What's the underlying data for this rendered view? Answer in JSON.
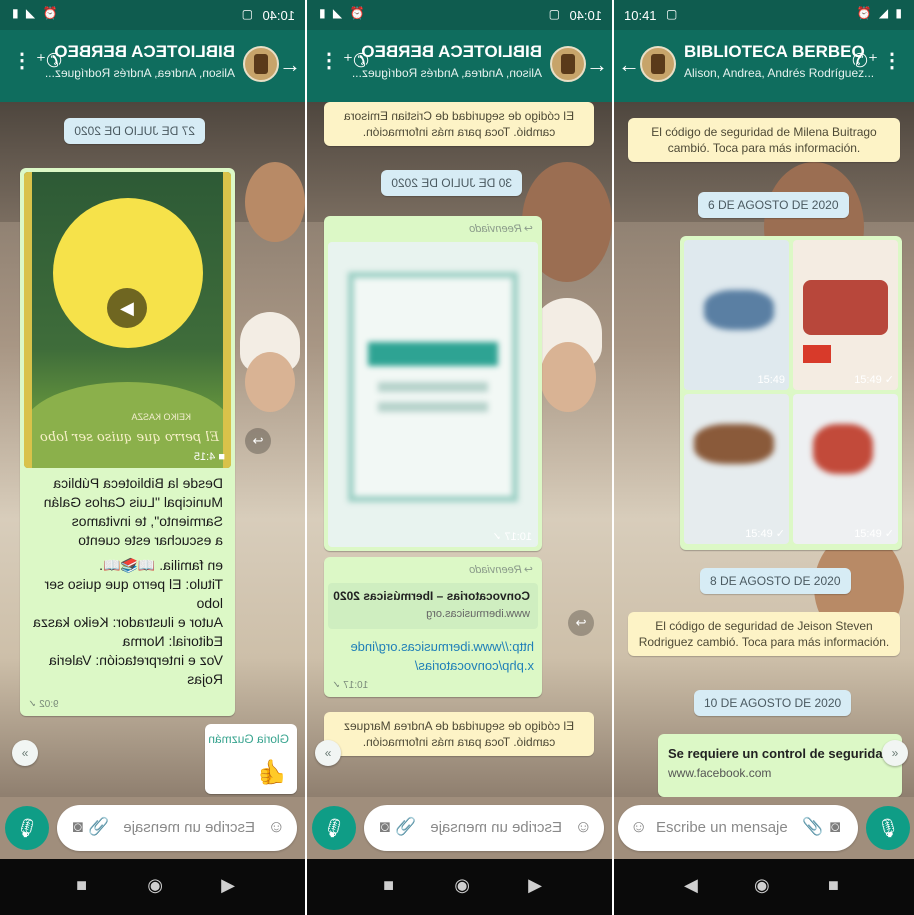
{
  "colors": {
    "header": "#0f6d5e",
    "statusbar": "#0f5c4f",
    "outgoing_bubble": "#dcf8c6",
    "date_chip": "#d7ecf5",
    "system_note": "#fdf3c6",
    "mic": "#0f9d86"
  },
  "screens": [
    {
      "mirrored": true,
      "status": {
        "time": "10:40"
      },
      "header": {
        "title": "BIBLIOTECA BERBEO",
        "subtitle": "Alison, Andrea, Andrés Rodríguez..."
      },
      "date_chip": "27 DE JULIO DE 2020",
      "video": {
        "title_on_cover": "El perro que quiso ser lobo",
        "author_on_cover": "KEIKO KASZA",
        "duration": "4:15"
      },
      "caption": [
        "Desde la Biblioteca Pública",
        "Municipal \"Luis Carlos Galán",
        "Sarmiento\", te invitamos",
        "a escuchar este cuento",
        "en familia. 📖📚📖.",
        "Titulo: El perro que quiso ser lobo",
        "Autor e ilustrador: Keiko kasza",
        "Editorial: Norma",
        "Voz e interpretación: Valeria Rojas"
      ],
      "caption_time": "9:02",
      "incoming": {
        "sender": "Gloria Guzmán",
        "emoji": "👍"
      },
      "input_placeholder": "Escribe un mensaje"
    },
    {
      "mirrored": true,
      "status": {
        "time": "10:40"
      },
      "header": {
        "title": "BIBLIOTECA BERBEO",
        "subtitle": "Alison, Andrea, Andrés Rodríguez..."
      },
      "security_top": "El código de seguridad de Cristian Emisora cambió. Toca para más información.",
      "date_chip": "30 DE JULIO DE 2020",
      "forwarded_label": "Reenviado",
      "image_time": "10:17",
      "link": {
        "title": "Convocatorias – Ibermúsicas 2020",
        "domain": "www.ibermusicas.org",
        "url": "http://www.ibermusicas.org/index.php/convocatorias/",
        "time": "10:17"
      },
      "security_bottom": "El código de seguridad de Andrea Marquez cambió. Toca para más información.",
      "input_placeholder": "Escribe un mensaje"
    },
    {
      "mirrored": false,
      "status": {
        "time": "10:41"
      },
      "header": {
        "title": "BIBLIOTECA BERBEO",
        "subtitle": "Alison, Andrea, Andrés Rodríguez..."
      },
      "security_1": "El código de seguridad de Milena Buitrago cambió. Toca para más información.",
      "date_1": "6 DE AGOSTO DE 2020",
      "grid_times": [
        "15:49",
        "15:49",
        "15:49",
        "15:49"
      ],
      "date_2": "8 DE AGOSTO DE 2020",
      "security_2": "El código de seguridad de Jeison Steven Rodriguez cambió. Toca para más información.",
      "date_3": "10 DE AGOSTO DE 2020",
      "link": {
        "title": "Se requiere un control de seguridad",
        "domain": "www.facebook.com"
      },
      "input_placeholder": "Escribe un mensaje"
    }
  ]
}
